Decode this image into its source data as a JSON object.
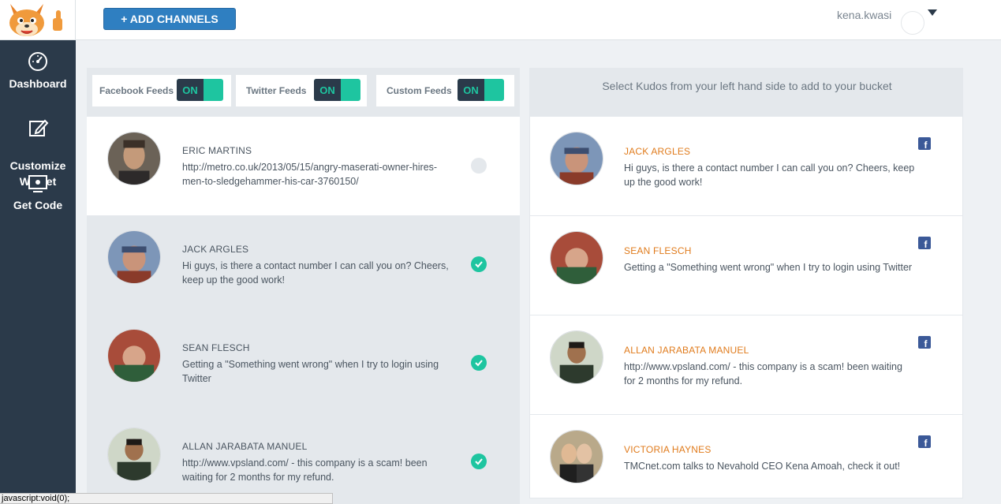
{
  "header": {
    "add_channels_label": "+ ADD CHANNELS",
    "username": "kena.kwasi"
  },
  "sidebar": {
    "items": [
      {
        "label": "Dashboard",
        "icon": "speedometer-icon"
      },
      {
        "label": "Customize\nWidget",
        "icon": "edit-icon"
      },
      {
        "label": "Get Code",
        "icon": "code-screen-icon"
      }
    ]
  },
  "toggles": [
    {
      "label": "Facebook Feeds",
      "state": "ON"
    },
    {
      "label": "Twitter Feeds",
      "state": "ON"
    },
    {
      "label": "Custom Feeds",
      "state": "ON"
    }
  ],
  "feed": [
    {
      "name": "ERIC MARTINS",
      "text": "http://metro.co.uk/2013/05/15/angry-maserati-owner-hires-men-to-sledgehammer-his-car-3760150/",
      "selected": false
    },
    {
      "name": "JACK ARGLES",
      "text": "Hi guys, is there a contact number I can call you on? Cheers, keep up the good work!",
      "selected": true
    },
    {
      "name": "SEAN FLESCH",
      "text": "Getting a \"Something went wrong\" when I try to login using Twitter",
      "selected": true
    },
    {
      "name": "ALLAN JARABATA MANUEL",
      "text": "http://www.vpsland.com/ - this company is a scam! been waiting for 2 months for my refund.",
      "selected": true
    }
  ],
  "bucket": {
    "header": "Select Kudos from your left hand side to add to your bucket",
    "items": [
      {
        "name": "JACK ARGLES",
        "text": "Hi guys, is there a contact number I can call you on? Cheers, keep up the good work!",
        "source": "facebook"
      },
      {
        "name": "SEAN FLESCH",
        "text": "Getting a \"Something went wrong\" when I try to login using Twitter",
        "source": "facebook"
      },
      {
        "name": "ALLAN JARABATA MANUEL",
        "text": "http://www.vpsland.com/ - this company is a scam! been waiting for 2 months for my refund.",
        "source": "facebook"
      },
      {
        "name": "VICTORIA HAYNES",
        "text": "TMCnet.com talks to Nevahold CEO Kena Amoah, check it out!",
        "source": "facebook"
      }
    ]
  },
  "status_bar": "javascript:void(0);",
  "colors": {
    "sidebar": "#2b3a4a",
    "accent_teal": "#1ec5a0",
    "button_blue": "#2f7fc1",
    "name_orange": "#e07b1c",
    "facebook": "#3b5998"
  }
}
